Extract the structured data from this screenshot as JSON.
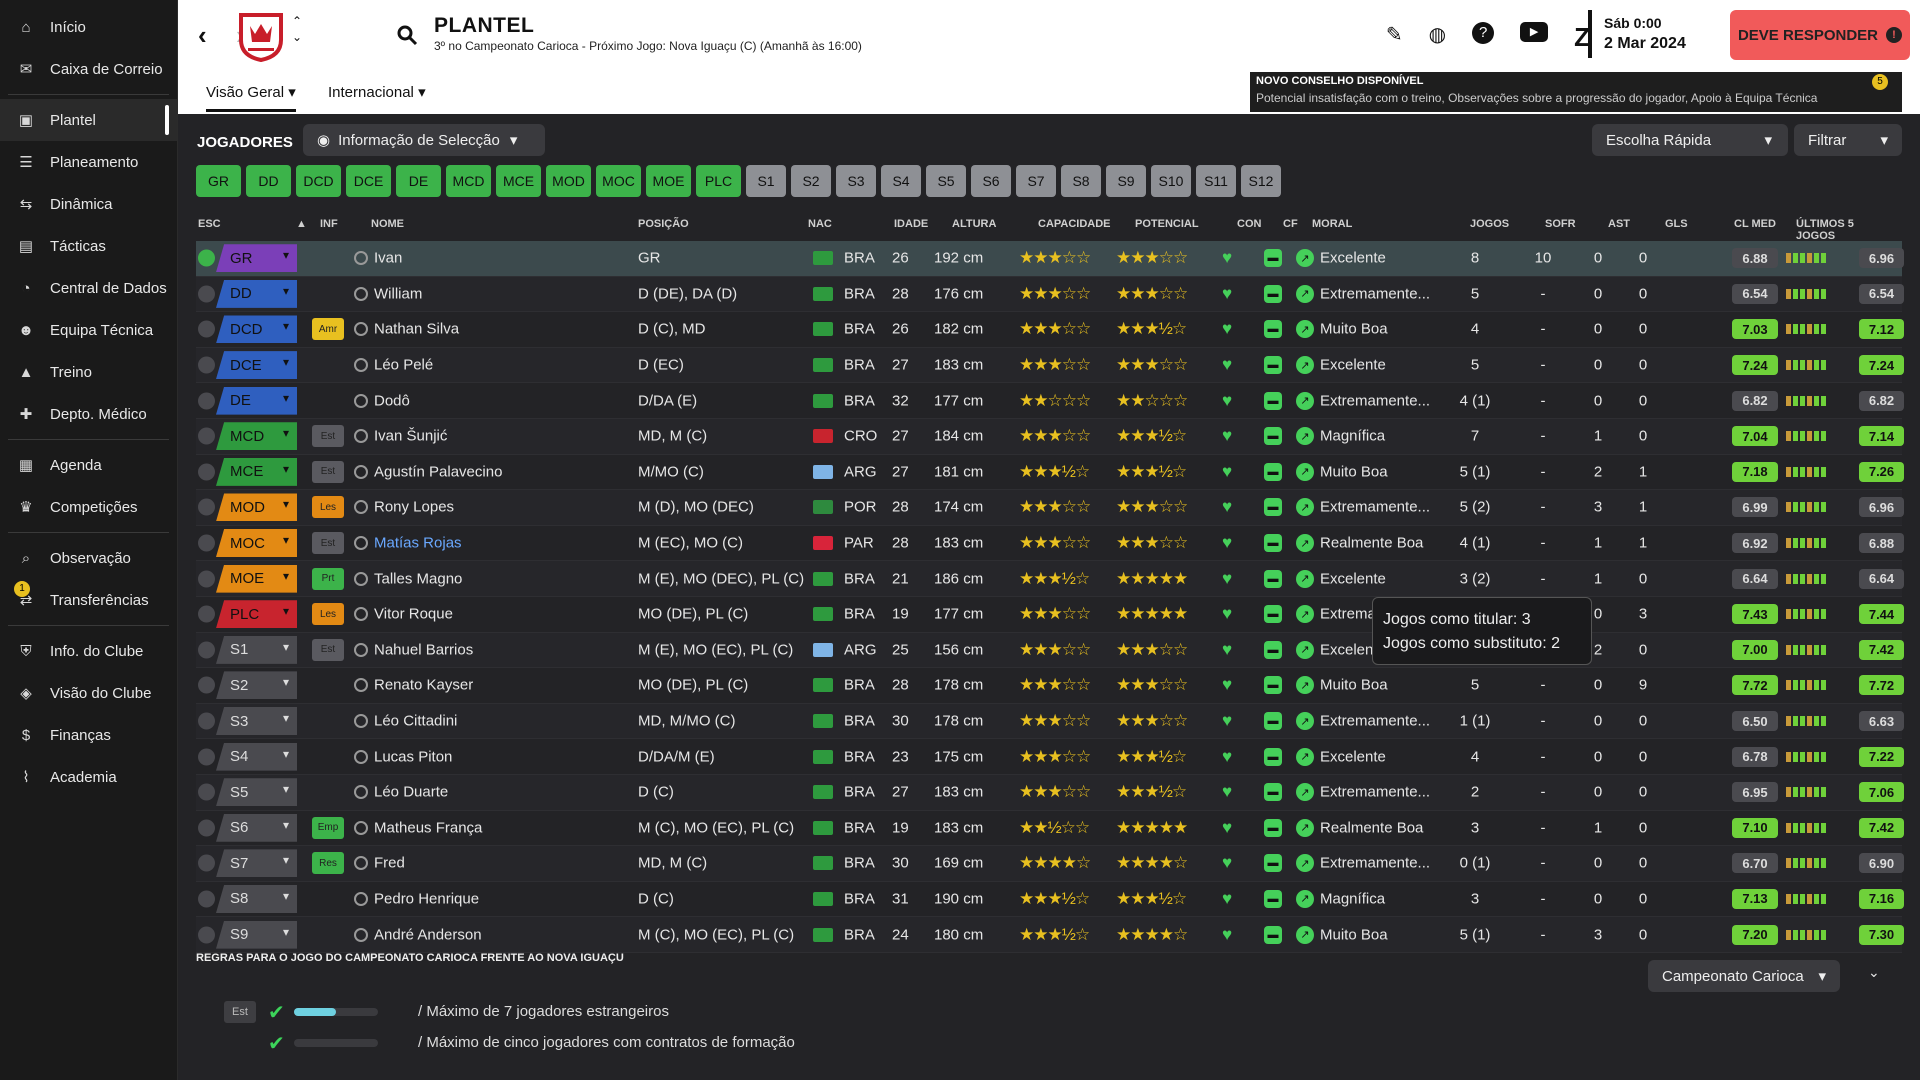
{
  "sidebar": {
    "items": [
      {
        "label": "Início",
        "icon": "home-icon"
      },
      {
        "label": "Caixa de Correio",
        "icon": "mail-icon"
      },
      {
        "label": "Plantel",
        "icon": "shirt-icon",
        "active": true
      },
      {
        "label": "Planeamento",
        "icon": "planning-icon"
      },
      {
        "label": "Dinâmica",
        "icon": "dynamics-icon"
      },
      {
        "label": "Tácticas",
        "icon": "tactics-icon"
      },
      {
        "label": "Central de Dados",
        "icon": "data-icon"
      },
      {
        "label": "Equipa Técnica",
        "icon": "staff-icon"
      },
      {
        "label": "Treino",
        "icon": "training-icon"
      },
      {
        "label": "Depto. Médico",
        "icon": "medical-icon"
      },
      {
        "label": "Agenda",
        "icon": "calendar-icon"
      },
      {
        "label": "Competições",
        "icon": "trophy-icon"
      },
      {
        "label": "Observação",
        "icon": "scouting-icon"
      },
      {
        "label": "Transferências",
        "icon": "transfer-icon",
        "badge": "1"
      },
      {
        "label": "Info. do Clube",
        "icon": "club-icon"
      },
      {
        "label": "Visão do Clube",
        "icon": "vision-icon"
      },
      {
        "label": "Finanças",
        "icon": "finance-icon"
      },
      {
        "label": "Academia",
        "icon": "academy-icon"
      }
    ]
  },
  "header": {
    "title": "PLANTEL",
    "subtitle": "3º no Campeonato Carioca - Próximo Jogo: Nova Iguaçu (C) (Amanhã às 16:00)",
    "day": "Sáb 0:00",
    "date": "2 Mar 2024",
    "respond": "DEVE RESPONDER"
  },
  "tabs": {
    "overview": "Visão Geral",
    "international": "Internacional"
  },
  "notice": {
    "title": "NOVO CONSELHO DISPONÍVEL",
    "body": "Potencial insatisfação com o treino, Observações sobre a progressão do jogador, Apoio à Equipa Técnica",
    "count": "5"
  },
  "toolbar": {
    "section": "JOGADORES",
    "view": "Informação de Selecção",
    "quick": "Escolha Rápida",
    "filter": "Filtrar"
  },
  "chips": {
    "green": [
      "GR",
      "DD",
      "DCD",
      "DCE",
      "DE",
      "MCD",
      "MCE",
      "MOD",
      "MOC",
      "MOE",
      "PLC"
    ],
    "grey": [
      "S1",
      "S2",
      "S3",
      "S4",
      "S5",
      "S6",
      "S7",
      "S8",
      "S9",
      "S10",
      "S11",
      "S12"
    ]
  },
  "columns": {
    "esc": "ESC",
    "inf": "INF",
    "nome": "NOME",
    "posicao": "POSIÇÃO",
    "nac": "NAC",
    "idade": "IDADE",
    "altura": "ALTURA",
    "capacidade": "CAPACIDADE",
    "potencial": "POTENCIAL",
    "con": "CON",
    "cf": "CF",
    "moral": "MORAL",
    "jogos": "JOGOS",
    "sofr": "SOFR",
    "ast": "AST",
    "gls": "GLS",
    "clmed": "CL MED",
    "ultimos": "ÚLTIMOS 5 JOGOS"
  },
  "players": [
    {
      "esc": "GR",
      "inf": "",
      "name": "Ivan",
      "pos": "GR",
      "nac": "BRA",
      "age": "26",
      "h": "192 cm",
      "cap": "★★★☆☆",
      "pot": "★★★☆☆",
      "moral": "Excelente",
      "jogos": "8",
      "sofr": "10",
      "ast": "0",
      "gls": "0",
      "cl": "6.88",
      "ult": "6.96",
      "sel": true
    },
    {
      "esc": "DD",
      "inf": "",
      "name": "William",
      "pos": "D (DE), DA (D)",
      "nac": "BRA",
      "age": "28",
      "h": "176 cm",
      "cap": "★★★☆☆",
      "pot": "★★★☆☆",
      "moral": "Extremamente...",
      "jogos": "5",
      "sofr": "-",
      "ast": "0",
      "gls": "0",
      "cl": "6.54",
      "ult": "6.54"
    },
    {
      "esc": "DCD",
      "inf": "Amr",
      "name": "Nathan Silva",
      "pos": "D (C), MD",
      "nac": "BRA",
      "age": "26",
      "h": "182 cm",
      "cap": "★★★☆☆",
      "pot": "★★★½☆",
      "moral": "Muito Boa",
      "jogos": "4",
      "sofr": "-",
      "ast": "0",
      "gls": "0",
      "cl": "7.03",
      "ult": "7.12"
    },
    {
      "esc": "DCE",
      "inf": "",
      "name": "Léo Pelé",
      "pos": "D (EC)",
      "nac": "BRA",
      "age": "27",
      "h": "183 cm",
      "cap": "★★★☆☆",
      "pot": "★★★☆☆",
      "moral": "Excelente",
      "jogos": "5",
      "sofr": "-",
      "ast": "0",
      "gls": "0",
      "cl": "7.24",
      "ult": "7.24"
    },
    {
      "esc": "DE",
      "inf": "",
      "name": "Dodô",
      "pos": "D/DA (E)",
      "nac": "BRA",
      "age": "32",
      "h": "177 cm",
      "cap": "★★☆☆☆",
      "pot": "★★☆☆☆",
      "moral": "Extremamente...",
      "jogos": "4 (1)",
      "sofr": "-",
      "ast": "0",
      "gls": "0",
      "cl": "6.82",
      "ult": "6.82"
    },
    {
      "esc": "MCD",
      "inf": "Est",
      "name": "Ivan Šunjić",
      "pos": "MD, M (C)",
      "nac": "CRO",
      "age": "27",
      "h": "184 cm",
      "cap": "★★★☆☆",
      "pot": "★★★½☆",
      "moral": "Magnífica",
      "jogos": "7",
      "sofr": "-",
      "ast": "1",
      "gls": "0",
      "cl": "7.04",
      "ult": "7.14"
    },
    {
      "esc": "MCE",
      "inf": "Est",
      "name": "Agustín Palavecino",
      "pos": "M/MO (C)",
      "nac": "ARG",
      "age": "27",
      "h": "181 cm",
      "cap": "★★★½☆",
      "pot": "★★★½☆",
      "moral": "Muito Boa",
      "jogos": "5 (1)",
      "sofr": "-",
      "ast": "2",
      "gls": "1",
      "cl": "7.18",
      "ult": "7.26"
    },
    {
      "esc": "MOD",
      "inf": "Les",
      "name": "Rony Lopes",
      "pos": "M (D), MO (DEC)",
      "nac": "POR",
      "age": "28",
      "h": "174 cm",
      "cap": "★★★☆☆",
      "pot": "★★★☆☆",
      "moral": "Extremamente...",
      "jogos": "5 (2)",
      "sofr": "-",
      "ast": "3",
      "gls": "1",
      "cl": "6.99",
      "ult": "6.96"
    },
    {
      "esc": "MOC",
      "inf": "Est",
      "name": "Matías Rojas",
      "pos": "M (EC), MO (C)",
      "nac": "PAR",
      "age": "28",
      "h": "183 cm",
      "cap": "★★★☆☆",
      "pot": "★★★☆☆",
      "moral": "Realmente Boa",
      "jogos": "4 (1)",
      "sofr": "-",
      "ast": "1",
      "gls": "1",
      "cl": "6.92",
      "ult": "6.88"
    },
    {
      "esc": "MOE",
      "inf": "Prt",
      "name": "Talles Magno",
      "pos": "M (E), MO (DEC), PL (C)",
      "nac": "BRA",
      "age": "21",
      "h": "186 cm",
      "cap": "★★★½☆",
      "pot": "★★★★★",
      "moral": "Excelente",
      "jogos": "3 (2)",
      "sofr": "-",
      "ast": "1",
      "gls": "0",
      "cl": "6.64",
      "ult": "6.64"
    },
    {
      "esc": "PLC",
      "inf": "Les",
      "name": "Vitor Roque",
      "pos": "MO (DE), PL (C)",
      "nac": "BRA",
      "age": "19",
      "h": "177 cm",
      "cap": "★★★☆☆",
      "pot": "★★★★★",
      "moral": "Extremamente...",
      "jogos": "",
      "sofr": "",
      "ast": "0",
      "gls": "3",
      "cl": "7.43",
      "ult": "7.44"
    },
    {
      "esc": "S1",
      "inf": "Est",
      "name": "Nahuel Barrios",
      "pos": "M (E), MO (EC), PL (C)",
      "nac": "ARG",
      "age": "25",
      "h": "156 cm",
      "cap": "★★★☆☆",
      "pot": "★★★☆☆",
      "moral": "Excelente",
      "jogos": "",
      "sofr": "",
      "ast": "2",
      "gls": "0",
      "cl": "7.00",
      "ult": "7.42"
    },
    {
      "esc": "S2",
      "inf": "",
      "name": "Renato Kayser",
      "pos": "MO (DE), PL (C)",
      "nac": "BRA",
      "age": "28",
      "h": "178 cm",
      "cap": "★★★☆☆",
      "pot": "★★★☆☆",
      "moral": "Muito Boa",
      "jogos": "5",
      "sofr": "-",
      "ast": "0",
      "gls": "9",
      "cl": "7.72",
      "ult": "7.72"
    },
    {
      "esc": "S3",
      "inf": "",
      "name": "Léo Cittadini",
      "pos": "MD, M/MO (C)",
      "nac": "BRA",
      "age": "30",
      "h": "178 cm",
      "cap": "★★★☆☆",
      "pot": "★★★☆☆",
      "moral": "Extremamente...",
      "jogos": "1 (1)",
      "sofr": "-",
      "ast": "0",
      "gls": "0",
      "cl": "6.50",
      "ult": "6.63"
    },
    {
      "esc": "S4",
      "inf": "",
      "name": "Lucas Piton",
      "pos": "D/DA/M (E)",
      "nac": "BRA",
      "age": "23",
      "h": "175 cm",
      "cap": "★★★☆☆",
      "pot": "★★★½☆",
      "moral": "Excelente",
      "jogos": "4",
      "sofr": "-",
      "ast": "0",
      "gls": "0",
      "cl": "6.78",
      "ult": "7.22"
    },
    {
      "esc": "S5",
      "inf": "",
      "name": "Léo Duarte",
      "pos": "D (C)",
      "nac": "BRA",
      "age": "27",
      "h": "183 cm",
      "cap": "★★★☆☆",
      "pot": "★★★½☆",
      "moral": "Extremamente...",
      "jogos": "2",
      "sofr": "-",
      "ast": "0",
      "gls": "0",
      "cl": "6.95",
      "ult": "7.06"
    },
    {
      "esc": "S6",
      "inf": "Emp",
      "name": "Matheus França",
      "pos": "M (C), MO (EC), PL (C)",
      "nac": "BRA",
      "age": "19",
      "h": "183 cm",
      "cap": "★★½☆☆",
      "pot": "★★★★★",
      "moral": "Realmente Boa",
      "jogos": "3",
      "sofr": "-",
      "ast": "1",
      "gls": "0",
      "cl": "7.10",
      "ult": "7.42"
    },
    {
      "esc": "S7",
      "inf": "Res",
      "name": "Fred",
      "pos": "MD, M (C)",
      "nac": "BRA",
      "age": "30",
      "h": "169 cm",
      "cap": "★★★★☆",
      "pot": "★★★★☆",
      "moral": "Extremamente...",
      "jogos": "0 (1)",
      "sofr": "-",
      "ast": "0",
      "gls": "0",
      "cl": "6.70",
      "ult": "6.90"
    },
    {
      "esc": "S8",
      "inf": "",
      "name": "Pedro Henrique",
      "pos": "D (C)",
      "nac": "BRA",
      "age": "31",
      "h": "190 cm",
      "cap": "★★★½☆",
      "pot": "★★★½☆",
      "moral": "Magnífica",
      "jogos": "3",
      "sofr": "-",
      "ast": "0",
      "gls": "0",
      "cl": "7.13",
      "ult": "7.16"
    },
    {
      "esc": "S9",
      "inf": "",
      "name": "André Anderson",
      "pos": "M (C), MO (EC), PL (C)",
      "nac": "BRA",
      "age": "24",
      "h": "180 cm",
      "cap": "★★★½☆",
      "pot": "★★★★☆",
      "moral": "Muito Boa",
      "jogos": "5 (1)",
      "sofr": "-",
      "ast": "3",
      "gls": "0",
      "cl": "7.20",
      "ult": "7.30"
    }
  ],
  "tooltip": {
    "line1": "Jogos como titular: 3",
    "line2": "Jogos como substituto: 2"
  },
  "rules": {
    "title": "REGRAS PARA O JOGO DO CAMPEONATO CARIOCA FRENTE AO NOVA IGUAÇU",
    "competition": "Campeonato Carioca",
    "est": "Est",
    "r1": "/   Máximo de 7 jogadores estrangeiros",
    "r2": "/   Máximo de cinco jogadores com contratos de formação",
    "r1_fill": 0.5,
    "r2_fill": 0
  }
}
